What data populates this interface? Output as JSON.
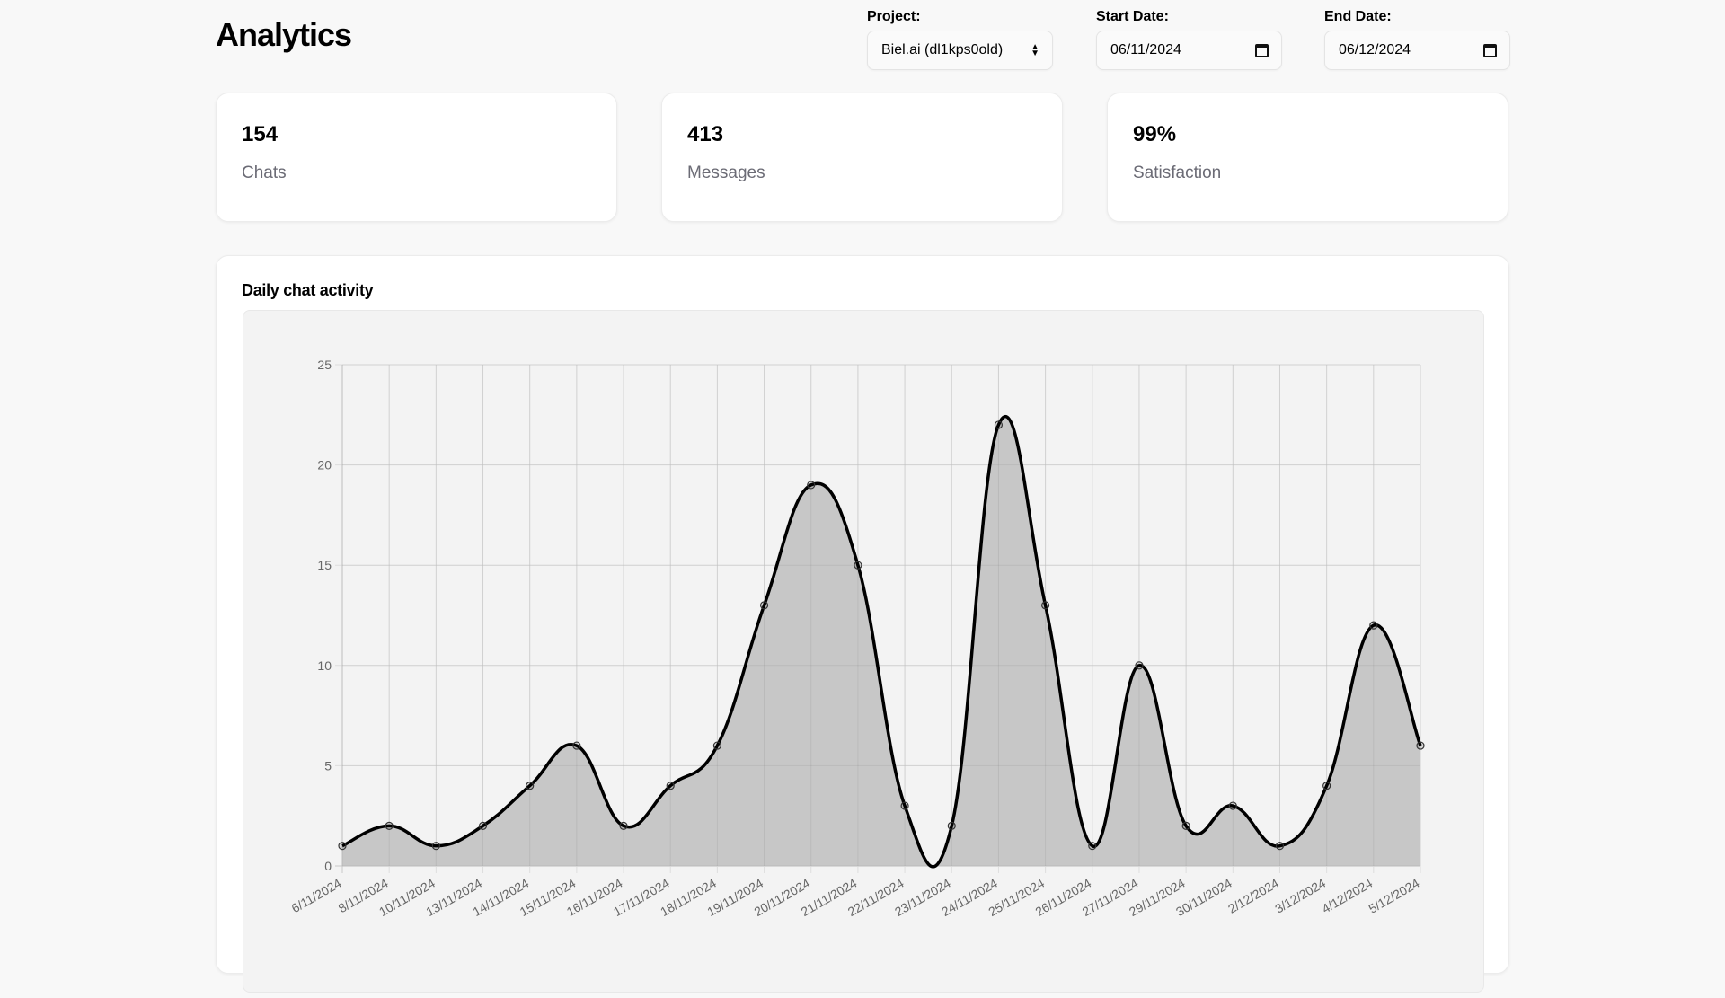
{
  "header": {
    "title": "Analytics",
    "project_label": "Project:",
    "project_value": "Biel.ai (dl1kps0old)",
    "start_label": "Start Date:",
    "start_value": "06/11/2024",
    "end_label": "End Date:",
    "end_value": "06/12/2024"
  },
  "stats": [
    {
      "value": "154",
      "label": "Chats"
    },
    {
      "value": "413",
      "label": "Messages"
    },
    {
      "value": "99%",
      "label": "Satisfaction"
    }
  ],
  "chart_panel": {
    "title": "Daily chat activity"
  },
  "chart_data": {
    "type": "area",
    "title": "Daily chat activity",
    "xlabel": "",
    "ylabel": "",
    "ylim": [
      0,
      25
    ],
    "yticks": [
      0,
      5,
      10,
      15,
      20,
      25
    ],
    "grid": true,
    "legend": "none",
    "categories": [
      "6/11/2024",
      "8/11/2024",
      "10/11/2024",
      "13/11/2024",
      "14/11/2024",
      "15/11/2024",
      "16/11/2024",
      "17/11/2024",
      "18/11/2024",
      "19/11/2024",
      "20/11/2024",
      "21/11/2024",
      "22/11/2024",
      "23/11/2024",
      "24/11/2024",
      "25/11/2024",
      "26/11/2024",
      "27/11/2024",
      "29/11/2024",
      "30/11/2024",
      "2/12/2024",
      "3/12/2024",
      "4/12/2024",
      "5/12/2024"
    ],
    "series": [
      {
        "name": "Chats",
        "values": [
          1,
          2,
          1,
          2,
          4,
          6,
          2,
          4,
          6,
          13,
          19,
          15,
          3,
          2,
          22,
          13,
          1,
          10,
          2,
          3,
          1,
          4,
          12,
          6
        ],
        "line_color": "#000000",
        "fill_color": "#c4c4c4"
      }
    ]
  }
}
